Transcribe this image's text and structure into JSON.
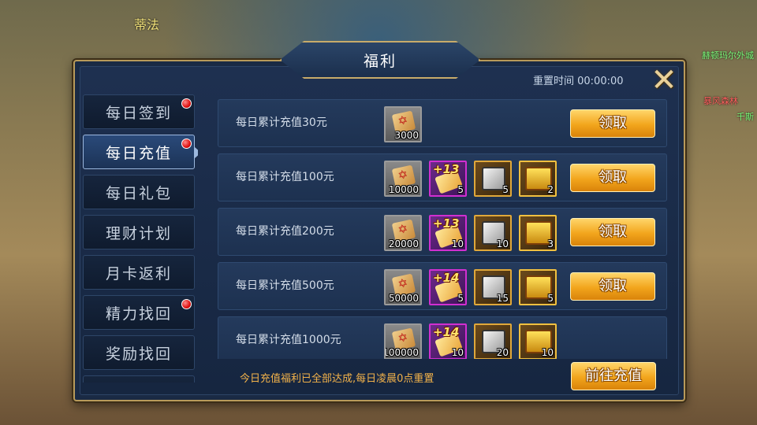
{
  "background": {
    "name_top": "蒂法",
    "right_label_1": "赫顿玛尔外城",
    "right_label_2": "暴风森林",
    "right_label_3": "千斯"
  },
  "panel": {
    "title": "福利",
    "reset_time": "重置时间 00:00:00"
  },
  "sidebar": {
    "tabs": [
      {
        "label": "每日签到",
        "badge": true,
        "active": false
      },
      {
        "label": "每日充值",
        "badge": true,
        "active": true
      },
      {
        "label": "每日礼包",
        "badge": false,
        "active": false
      },
      {
        "label": "理财计划",
        "badge": false,
        "active": false
      },
      {
        "label": "月卡返利",
        "badge": false,
        "active": false
      },
      {
        "label": "精力找回",
        "badge": true,
        "active": false
      },
      {
        "label": "奖励找回",
        "badge": false,
        "active": false
      }
    ]
  },
  "rows": [
    {
      "label": "每日累计充值30元",
      "button": "领取",
      "items": [
        {
          "icon": "gold-scroll-icon",
          "type": "scroll",
          "qty": "3000"
        }
      ]
    },
    {
      "label": "每日累计充值100元",
      "button": "领取",
      "items": [
        {
          "icon": "gold-scroll-icon",
          "type": "scroll",
          "qty": "10000"
        },
        {
          "icon": "enhance-scroll-icon",
          "type": "enhance",
          "tag": "+13",
          "qty": "5"
        },
        {
          "icon": "dice-box-icon",
          "type": "box",
          "qty": "5"
        },
        {
          "icon": "treasure-chest-icon",
          "type": "chest",
          "qty": "2"
        }
      ]
    },
    {
      "label": "每日累计充值200元",
      "button": "领取",
      "items": [
        {
          "icon": "gold-scroll-icon",
          "type": "scroll",
          "qty": "20000"
        },
        {
          "icon": "enhance-scroll-icon",
          "type": "enhance",
          "tag": "+13",
          "qty": "10"
        },
        {
          "icon": "dice-box-icon",
          "type": "box",
          "qty": "10"
        },
        {
          "icon": "treasure-chest-icon",
          "type": "chest",
          "qty": "3"
        }
      ]
    },
    {
      "label": "每日累计充值500元",
      "button": "领取",
      "items": [
        {
          "icon": "gold-scroll-icon",
          "type": "scroll",
          "qty": "50000"
        },
        {
          "icon": "enhance-scroll-icon",
          "type": "enhance",
          "tag": "+14",
          "qty": "5"
        },
        {
          "icon": "dice-box-icon",
          "type": "box",
          "qty": "15"
        },
        {
          "icon": "treasure-chest-icon",
          "type": "chest",
          "qty": "5"
        }
      ]
    },
    {
      "label": "每日累计充值1000元",
      "button": "",
      "items": [
        {
          "icon": "gold-scroll-icon",
          "type": "scroll",
          "qty": "100000"
        },
        {
          "icon": "enhance-scroll-icon",
          "type": "enhance",
          "tag": "+14",
          "qty": "10"
        },
        {
          "icon": "dice-box-icon",
          "type": "box",
          "qty": "20"
        },
        {
          "icon": "treasure-chest-icon",
          "type": "chest",
          "qty": "10"
        }
      ]
    }
  ],
  "footer": {
    "note": "今日充值福利已全部达成,每日凌晨0点重置",
    "go_button": "前往充值"
  },
  "colors": {
    "accent_gold": "#f2a51c",
    "panel_bg": "#1a2a44",
    "badge_red": "#e01010",
    "note_orange": "#f2b24a"
  }
}
